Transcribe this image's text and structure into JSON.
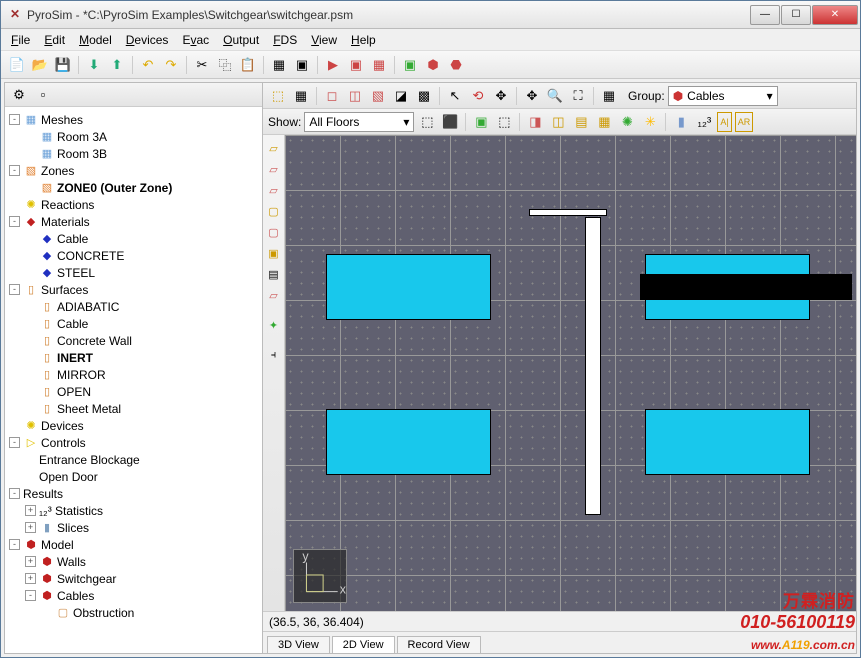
{
  "title": "PyroSim - *C:\\PyroSim Examples\\Switchgear\\switchgear.psm",
  "menu": [
    "File",
    "Edit",
    "Model",
    "Devices",
    "Evac",
    "Output",
    "FDS",
    "View",
    "Help"
  ],
  "group_label": "Group:",
  "group_value": "Cables",
  "show_label": "Show:",
  "floors_value": "All Floors",
  "status": "(36.5, 36, 36.404)",
  "tabs": [
    "3D View",
    "2D View",
    "Record View"
  ],
  "active_tab": 1,
  "tree": [
    {
      "ind": 0,
      "exp": "-",
      "icon": "▦",
      "color": "#6aa0d8",
      "label": "Meshes"
    },
    {
      "ind": 1,
      "exp": "",
      "icon": "▦",
      "color": "#6aa0d8",
      "label": "Room 3A"
    },
    {
      "ind": 1,
      "exp": "",
      "icon": "▦",
      "color": "#6aa0d8",
      "label": "Room 3B"
    },
    {
      "ind": 0,
      "exp": "-",
      "icon": "▧",
      "color": "#e08030",
      "label": "Zones"
    },
    {
      "ind": 1,
      "exp": "",
      "icon": "▧",
      "color": "#e08030",
      "label": "ZONE0 (Outer Zone)",
      "bold": true
    },
    {
      "ind": 0,
      "exp": "",
      "icon": "✺",
      "color": "#e0c000",
      "label": "Reactions"
    },
    {
      "ind": 0,
      "exp": "-",
      "icon": "◆",
      "color": "#c02020",
      "label": "Materials"
    },
    {
      "ind": 1,
      "exp": "",
      "icon": "◆",
      "color": "#2030c0",
      "label": "Cable"
    },
    {
      "ind": 1,
      "exp": "",
      "icon": "◆",
      "color": "#2030c0",
      "label": "CONCRETE"
    },
    {
      "ind": 1,
      "exp": "",
      "icon": "◆",
      "color": "#2030c0",
      "label": "STEEL"
    },
    {
      "ind": 0,
      "exp": "-",
      "icon": "▯",
      "color": "#d08030",
      "label": "Surfaces"
    },
    {
      "ind": 1,
      "exp": "",
      "icon": "▯",
      "color": "#d08030",
      "label": "ADIABATIC"
    },
    {
      "ind": 1,
      "exp": "",
      "icon": "▯",
      "color": "#d08030",
      "label": "Cable"
    },
    {
      "ind": 1,
      "exp": "",
      "icon": "▯",
      "color": "#d08030",
      "label": "Concrete Wall"
    },
    {
      "ind": 1,
      "exp": "",
      "icon": "▯",
      "color": "#d08030",
      "label": "INERT",
      "bold": true
    },
    {
      "ind": 1,
      "exp": "",
      "icon": "▯",
      "color": "#d08030",
      "label": "MIRROR"
    },
    {
      "ind": 1,
      "exp": "",
      "icon": "▯",
      "color": "#d08030",
      "label": "OPEN"
    },
    {
      "ind": 1,
      "exp": "",
      "icon": "▯",
      "color": "#d08030",
      "label": "Sheet Metal"
    },
    {
      "ind": 0,
      "exp": "",
      "icon": "✺",
      "color": "#e0c000",
      "label": "Devices"
    },
    {
      "ind": 0,
      "exp": "-",
      "icon": "▷",
      "color": "#e0c000",
      "label": "Controls"
    },
    {
      "ind": 1,
      "exp": "",
      "icon": "",
      "color": "",
      "label": "Entrance Blockage"
    },
    {
      "ind": 1,
      "exp": "",
      "icon": "",
      "color": "",
      "label": "Open Door"
    },
    {
      "ind": 0,
      "exp": "-",
      "icon": "",
      "color": "",
      "label": "Results"
    },
    {
      "ind": 1,
      "exp": "+",
      "icon": "",
      "color": "",
      "label": "₁₂³ Statistics"
    },
    {
      "ind": 1,
      "exp": "+",
      "icon": "▮",
      "color": "#80a0c0",
      "label": "Slices"
    },
    {
      "ind": 0,
      "exp": "-",
      "icon": "⬢",
      "color": "#c02020",
      "label": "Model"
    },
    {
      "ind": 1,
      "exp": "+",
      "icon": "⬢",
      "color": "#c02020",
      "label": "Walls"
    },
    {
      "ind": 1,
      "exp": "+",
      "icon": "⬢",
      "color": "#c02020",
      "label": "Switchgear"
    },
    {
      "ind": 1,
      "exp": "-",
      "icon": "⬢",
      "color": "#c02020",
      "label": "Cables"
    },
    {
      "ind": 2,
      "exp": "",
      "icon": "▢",
      "color": "#d09050",
      "label": "Obstruction"
    }
  ],
  "watermark": {
    "l1": "万霖消防",
    "l2": "010-56100119",
    "l3a": "www.",
    "l3b": "A119",
    "l3c": ".com.cn"
  }
}
